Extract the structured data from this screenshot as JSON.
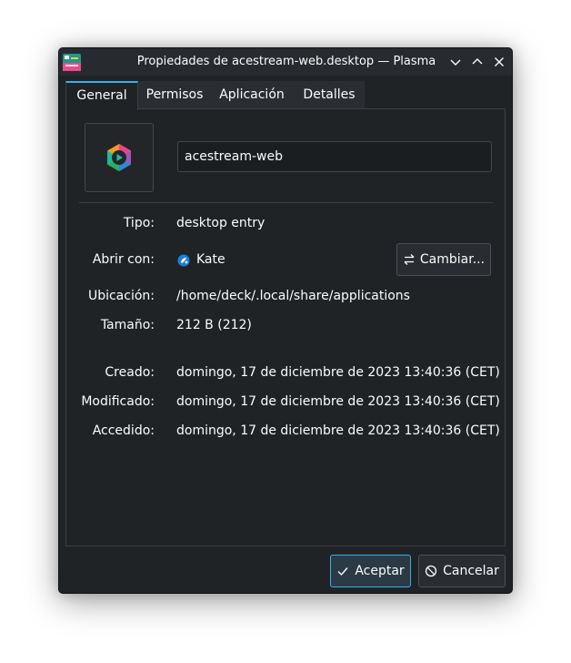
{
  "window": {
    "title": "Propiedades de acestream-web.desktop — Plasma"
  },
  "tabs": [
    {
      "label": "General",
      "active": true
    },
    {
      "label": "Permisos",
      "active": false
    },
    {
      "label": "Aplicación",
      "active": false
    },
    {
      "label": "Detalles",
      "active": false
    }
  ],
  "general": {
    "file_name": "acestream-web",
    "rows": {
      "type_label": "Tipo:",
      "type_value": "desktop entry",
      "open_with_label": "Abrir con:",
      "open_with_app": "Kate",
      "change_button": "Cambiar...",
      "location_label": "Ubicación:",
      "location_value": "/home/deck/.local/share/applications",
      "size_label": "Tamaño:",
      "size_value": "212 B (212)",
      "created_label": "Creado:",
      "created_value": "domingo, 17 de diciembre de 2023 13:40:36 (CET)",
      "modified_label": "Modificado:",
      "modified_value": "domingo, 17 de diciembre de 2023 13:40:36 (CET)",
      "accessed_label": "Accedido:",
      "accessed_value": "domingo, 17 de diciembre de 2023 13:40:36 (CET)"
    }
  },
  "buttons": {
    "ok": "Aceptar",
    "cancel": "Cancelar"
  },
  "icons": {
    "app": "kde-properties-icon",
    "file": "acestream-hexagon-icon",
    "kate": "kate-icon",
    "change": "swap-arrows-icon",
    "ok": "checkmark-icon",
    "cancel": "cancel-circle-icon"
  },
  "colors": {
    "accent": "#3daee9",
    "window_bg": "#202326",
    "text": "#fcfcfc"
  }
}
